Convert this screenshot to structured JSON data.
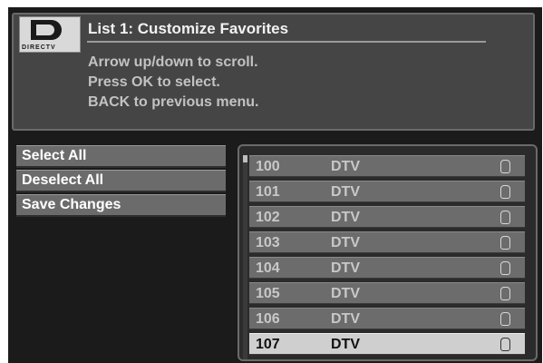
{
  "header": {
    "logo_text": "DIRECTV",
    "title": "List 1: Customize Favorites",
    "help_lines": [
      "Arrow up/down to scroll.",
      "Press OK to select.",
      "BACK to previous menu."
    ]
  },
  "menu": {
    "items": [
      {
        "label": "Select All"
      },
      {
        "label": "Deselect All"
      },
      {
        "label": "Save Changes"
      }
    ]
  },
  "channels": [
    {
      "number": "100",
      "name": "DTV",
      "checked": false,
      "selected": false
    },
    {
      "number": "101",
      "name": "DTV",
      "checked": false,
      "selected": false
    },
    {
      "number": "102",
      "name": "DTV",
      "checked": false,
      "selected": false
    },
    {
      "number": "103",
      "name": "DTV",
      "checked": false,
      "selected": false
    },
    {
      "number": "104",
      "name": "DTV",
      "checked": false,
      "selected": false
    },
    {
      "number": "105",
      "name": "DTV",
      "checked": false,
      "selected": false
    },
    {
      "number": "106",
      "name": "DTV",
      "checked": false,
      "selected": false
    },
    {
      "number": "107",
      "name": "DTV",
      "checked": false,
      "selected": true
    }
  ]
}
